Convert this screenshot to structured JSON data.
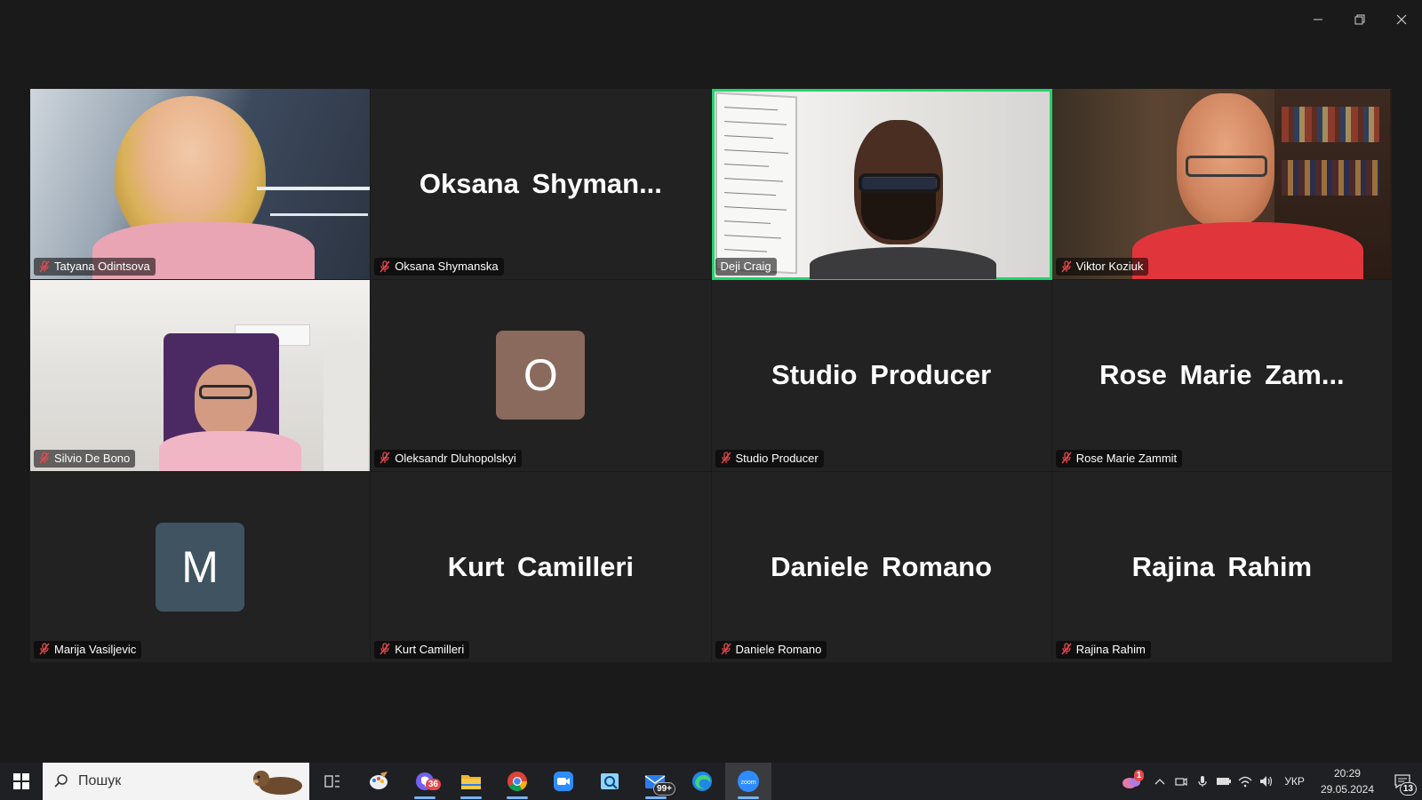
{
  "window": {
    "controls": [
      "minimize-icon",
      "restore-icon",
      "close-icon"
    ]
  },
  "gallery": {
    "active_speaker_color": "#22d36b",
    "tiles": [
      {
        "name": "Tatyana Odintsova",
        "kind": "video",
        "muted": true
      },
      {
        "name": "Oksana Shymanska",
        "kind": "name",
        "display": "Oksana  Shyman...",
        "muted": true
      },
      {
        "name": "Deji Craig",
        "kind": "video",
        "muted": false,
        "active": true
      },
      {
        "name": "Viktor Koziuk",
        "kind": "video",
        "muted": true
      },
      {
        "name": "Silvio De Bono",
        "kind": "video",
        "muted": true
      },
      {
        "name": "Oleksandr Dluhopolskyi",
        "kind": "avatar",
        "initial": "O",
        "avatar_color": "#8a6a5c",
        "muted": true
      },
      {
        "name": "Studio Producer",
        "kind": "name",
        "display": "Studio Producer",
        "muted": true
      },
      {
        "name": "Rose Marie Zammit",
        "kind": "name",
        "display": "Rose  Marie  Zam...",
        "muted": true
      },
      {
        "name": "Marija Vasiljevic",
        "kind": "avatar",
        "initial": "M",
        "avatar_color": "#3f5360",
        "muted": true
      },
      {
        "name": "Kurt Camilleri",
        "kind": "name",
        "display": "Kurt Camilleri",
        "muted": true
      },
      {
        "name": "Daniele Romano",
        "kind": "name",
        "display": "Daniele Romano",
        "muted": true
      },
      {
        "name": "Rajina Rahim",
        "kind": "name",
        "display": "Rajina Rahim",
        "muted": true
      }
    ]
  },
  "taskbar": {
    "search_placeholder": "Пошук",
    "apps": [
      {
        "icon": "task-view-icon",
        "open": false
      },
      {
        "icon": "paint-icon",
        "open": false
      },
      {
        "icon": "viber-icon",
        "open": true,
        "badge": "36"
      },
      {
        "icon": "file-explorer-icon",
        "open": true
      },
      {
        "icon": "chrome-icon",
        "open": true
      },
      {
        "icon": "zoom-app-icon",
        "open": false
      },
      {
        "icon": "screen-tool-icon",
        "open": false
      },
      {
        "icon": "mail-icon",
        "open": true,
        "badge": "99+"
      },
      {
        "icon": "edge-icon",
        "open": false
      },
      {
        "icon": "zoom-meeting-icon",
        "open": true,
        "current": true
      }
    ],
    "weather_badge": "1",
    "language": "УКР",
    "time": "20:29",
    "date": "29.05.2024",
    "notifications_count": "13"
  }
}
